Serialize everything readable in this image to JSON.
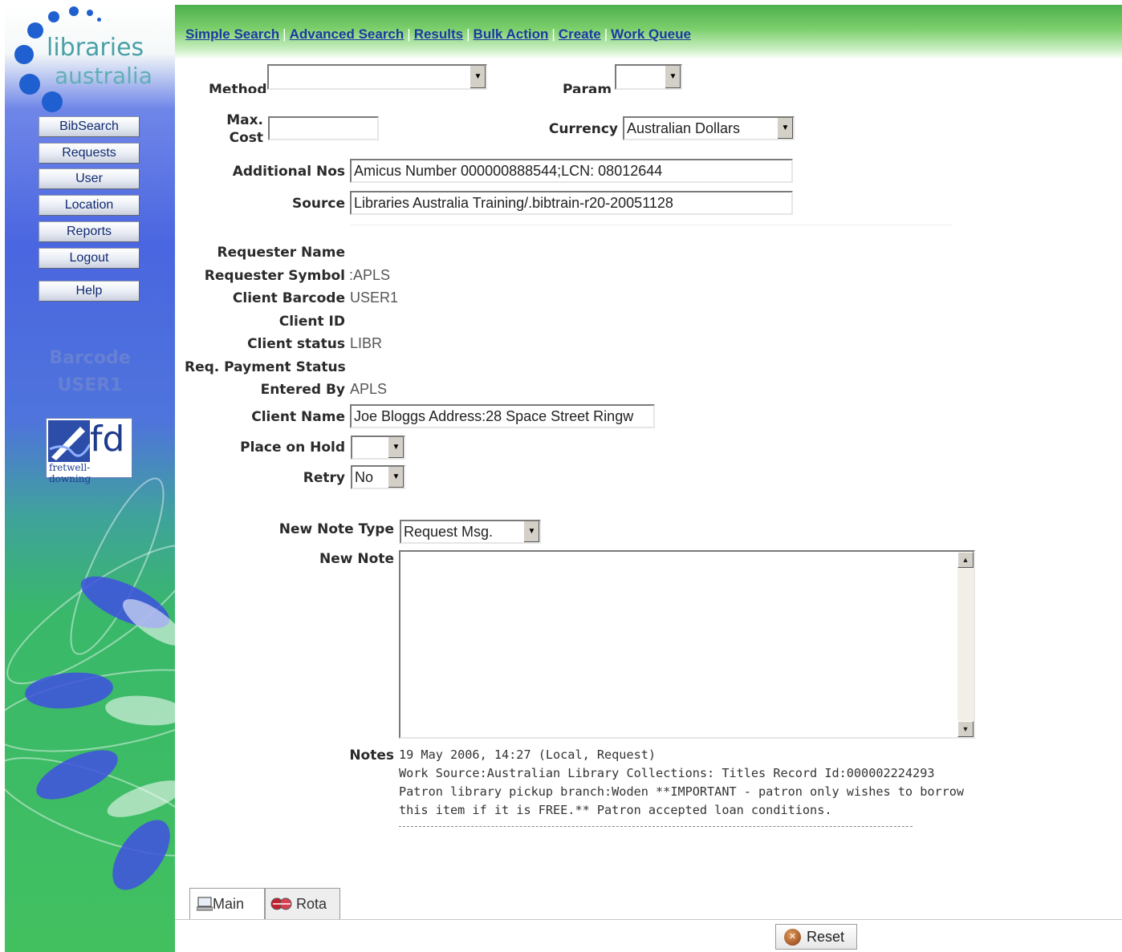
{
  "logo": {
    "line1": "libraries",
    "line2": "australia"
  },
  "nav": {
    "items": [
      "Simple Search",
      "Advanced Search",
      "Results",
      "Bulk Action",
      "Create",
      "Work Queue"
    ]
  },
  "sidebar": {
    "buttons": [
      "BibSearch",
      "Requests",
      "User",
      "Location",
      "Reports",
      "Logout",
      "Help"
    ],
    "barcode_label": "Barcode",
    "barcode_value": "USER1",
    "partner_logo": {
      "mark": "fd",
      "caption": "fretwell-downing"
    }
  },
  "form": {
    "method_label": "Method",
    "param_label": "Param",
    "max_cost_label_1": "Max.",
    "max_cost_label_2": "Cost",
    "max_cost_value": "",
    "currency_label": "Currency",
    "currency_value": "Australian Dollars",
    "additional_nos_label": "Additional Nos",
    "additional_nos_value": "Amicus Number 000000888544;LCN: 08012644",
    "source_label": "Source",
    "source_value": "Libraries Australia Training/.bibtrain-r20-20051128",
    "requester_name_label": "Requester Name",
    "requester_name_value": "",
    "requester_symbol_label": "Requester Symbol",
    "requester_symbol_value": ":APLS",
    "client_barcode_label": "Client Barcode",
    "client_barcode_value": "USER1",
    "client_id_label": "Client ID",
    "client_id_value": "",
    "client_status_label": "Client status",
    "client_status_value": "LIBR",
    "req_payment_label": "Req. Payment Status",
    "req_payment_value": "",
    "entered_by_label": "Entered By",
    "entered_by_value": "APLS",
    "client_name_label": "Client Name",
    "client_name_value": "Joe Bloggs Address:28 Space Street Ringw",
    "place_on_hold_label": "Place on Hold",
    "place_on_hold_value": "",
    "retry_label": "Retry",
    "retry_value": "No",
    "new_note_type_label": "New Note Type",
    "new_note_type_value": "Request Msg.",
    "new_note_label": "New Note",
    "new_note_value": "",
    "notes_label": "Notes",
    "notes_lines": [
      "19 May 2006, 14:27 (Local, Request)",
      "Work Source:Australian Library Collections: Titles Record Id:000002224293",
      "Patron library pickup branch:Woden **IMPORTANT - patron only wishes to borrow",
      "this item if it is FREE.** Patron accepted loan conditions."
    ]
  },
  "tabs": [
    "Main",
    "Rota"
  ],
  "active_tab": "Main",
  "footer": {
    "reset_label": "Reset"
  },
  "colors": {
    "nav_link": "#1a3aa0",
    "sidebar_blue": "#4a66e0",
    "sidebar_green": "#42c060",
    "top_band_green": "#4cb04c"
  },
  "icons": {
    "main_tab": "computer-icon",
    "rota_tab": "rota-icon",
    "reset": "reset-icon"
  }
}
